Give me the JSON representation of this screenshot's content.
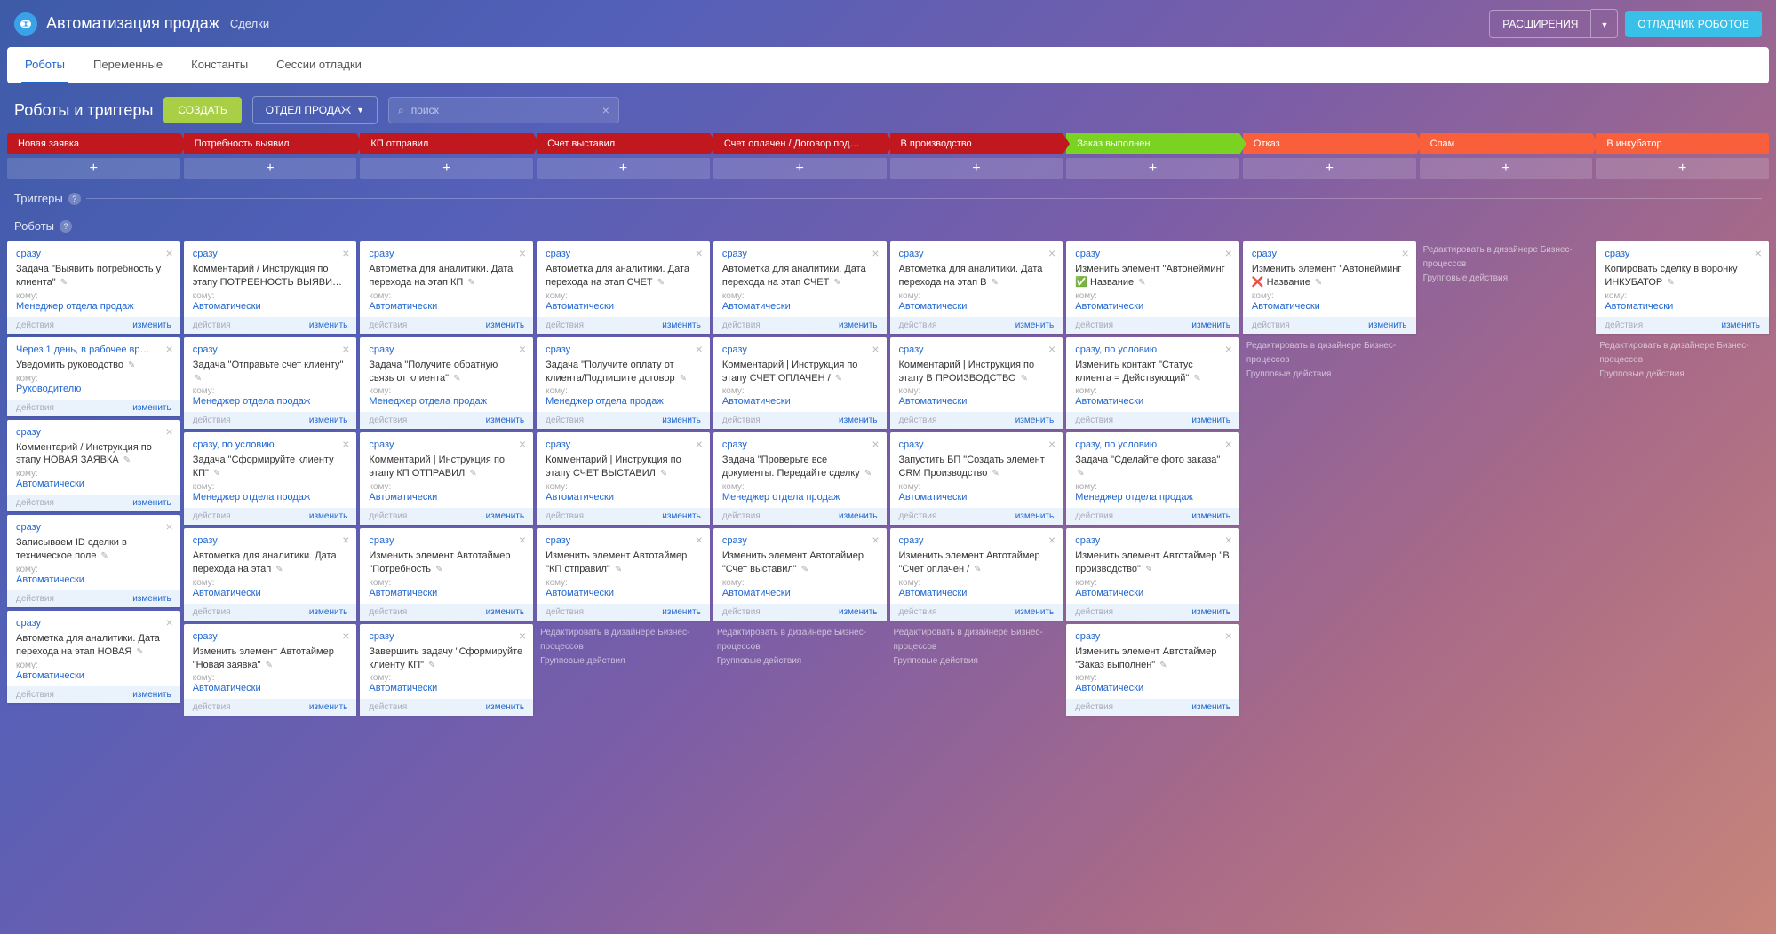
{
  "header": {
    "title": "Автоматизация продаж",
    "subtitle": "Сделки",
    "extensions": "РАСШИРЕНИЯ",
    "debugger": "ОТЛАДЧИК РОБОТОВ"
  },
  "tabs": [
    "Роботы",
    "Переменные",
    "Константы",
    "Сессии отладки"
  ],
  "activeTab": 0,
  "toolbar": {
    "section": "Роботы и триггеры",
    "create": "СОЗДАТЬ",
    "dept": "ОТДЕЛ ПРОДАЖ",
    "searchPlaceholder": "поиск"
  },
  "stages": [
    {
      "label": "Новая заявка",
      "bg": "#c1171f"
    },
    {
      "label": "Потребность выявил",
      "bg": "#c1171f"
    },
    {
      "label": "КП отправил",
      "bg": "#c1171f"
    },
    {
      "label": "Счет выставил",
      "bg": "#c1171f"
    },
    {
      "label": "Счет оплачен / Договор под…",
      "bg": "#c1171f"
    },
    {
      "label": "В производство",
      "bg": "#c1171f"
    },
    {
      "label": "Заказ выполнен",
      "bg": "#7ad321"
    },
    {
      "label": "Отказ",
      "bg": "#f85f3a"
    },
    {
      "label": "Спам",
      "bg": "#f85f3a"
    },
    {
      "label": "В инкубатор",
      "bg": "#f85f3a"
    }
  ],
  "labels": {
    "triggers": "Триггеры",
    "robots": "Роботы",
    "add": "+",
    "to": "кому:",
    "actions": "действия",
    "edit": "изменить",
    "link1": "Редактировать в дизайнере Бизнес-процессов",
    "link2": "Групповые действия"
  },
  "columns": [
    [
      {
        "when": "сразу",
        "desc": "Задача \"Выявить потребность у клиента\"",
        "to": "Менеджер отдела продаж"
      },
      {
        "when": "Через 1 день, в рабочее вр…",
        "desc": "Уведомить руководство",
        "to": "Руководителю"
      },
      {
        "when": "сразу",
        "desc": "Комментарий / Инструкция по этапу НОВАЯ ЗАЯВКА",
        "to": "Автоматически"
      },
      {
        "when": "сразу",
        "desc": "Записываем ID сделки в техническое поле",
        "to": "Автоматически"
      },
      {
        "when": "сразу",
        "desc": "Автометка для аналитики. Дата перехода на этап НОВАЯ",
        "to": "Автоматически"
      }
    ],
    [
      {
        "when": "сразу",
        "desc": "Комментарий / Инструкция по этапу ПОТРЕБНОСТЬ ВЫЯВИЛ",
        "to": "Автоматически"
      },
      {
        "when": "сразу",
        "desc": "Задача \"Отправьте счет клиенту\"",
        "to": "Менеджер отдела продаж"
      },
      {
        "when": "сразу, по условию",
        "desc": "Задача \"Сформируйте клиенту КП\"",
        "to": "Менеджер отдела продаж"
      },
      {
        "when": "сразу",
        "desc": "Автометка для аналитики. Дата перехода на этап",
        "to": "Автоматически"
      },
      {
        "when": "сразу",
        "desc": "Изменить элемент Автотаймер \"Новая заявка\"",
        "to": "Автоматически"
      }
    ],
    [
      {
        "when": "сразу",
        "desc": "Автометка для аналитики. Дата перехода на этап КП",
        "to": "Автоматически"
      },
      {
        "when": "сразу",
        "desc": "Задача \"Получите обратную связь от клиента\"",
        "to": "Менеджер отдела продаж"
      },
      {
        "when": "сразу",
        "desc": "Комментарий | Инструкция по этапу КП ОТПРАВИЛ",
        "to": "Автоматически"
      },
      {
        "when": "сразу",
        "desc": "Изменить элемент Автотаймер \"Потребность",
        "to": "Автоматически"
      },
      {
        "when": "сразу",
        "desc": "Завершить задачу \"Сформируйте клиенту КП\"",
        "to": "Автоматически"
      }
    ],
    [
      {
        "when": "сразу",
        "desc": "Автометка для аналитики. Дата перехода на этап СЧЕТ",
        "to": "Автоматически"
      },
      {
        "when": "сразу",
        "desc": "Задача \"Получите оплату от клиента/Подпишите договор",
        "to": "Менеджер отдела продаж"
      },
      {
        "when": "сразу",
        "desc": "Комментарий | Инструкция по этапу СЧЕТ ВЫСТАВИЛ",
        "to": "Автоматически"
      },
      {
        "when": "сразу",
        "desc": "Изменить элемент Автотаймер \"КП отправил\"",
        "to": "Автоматически"
      },
      "links"
    ],
    [
      {
        "when": "сразу",
        "desc": "Автометка для аналитики. Дата перехода на этап СЧЕТ",
        "to": "Автоматически"
      },
      {
        "when": "сразу",
        "desc": "Комментарий | Инструкция по этапу СЧЕТ ОПЛАЧЕН /",
        "to": "Автоматически"
      },
      {
        "when": "сразу",
        "desc": "Задача \"Проверьте все документы. Передайте сделку",
        "to": "Менеджер отдела продаж"
      },
      {
        "when": "сразу",
        "desc": "Изменить элемент Автотаймер \"Счет выставил\"",
        "to": "Автоматически"
      },
      "links"
    ],
    [
      {
        "when": "сразу",
        "desc": "Автометка для аналитики. Дата перехода на этап В",
        "to": "Автоматически"
      },
      {
        "when": "сразу",
        "desc": "Комментарий | Инструкция по этапу В ПРОИЗВОДСТВО",
        "to": "Автоматически"
      },
      {
        "when": "сразу",
        "desc": "Запустить БП \"Создать элемент CRM Производство",
        "to": "Автоматически"
      },
      {
        "when": "сразу",
        "desc": "Изменить элемент Автотаймер \"Счет оплачен /",
        "to": "Автоматически"
      },
      "links"
    ],
    [
      {
        "when": "сразу",
        "desc": "Изменить элемент \"Автонейминг ✅ Название",
        "to": "Автоматически"
      },
      {
        "when": "сразу, по условию",
        "desc": "Изменить контакт \"Статус клиента = Действующий\"",
        "to": "Автоматически"
      },
      {
        "when": "сразу, по условию",
        "desc": "Задача \"Сделайте фото заказа\"",
        "to": "Менеджер отдела продаж"
      },
      {
        "when": "сразу",
        "desc": "Изменить элемент Автотаймер \"В производство\"",
        "to": "Автоматически"
      },
      {
        "when": "сразу",
        "desc": "Изменить элемент Автотаймер \"Заказ выполнен\"",
        "to": "Автоматически"
      }
    ],
    [
      {
        "when": "сразу",
        "desc": "Изменить элемент \"Автонейминг ❌ Название",
        "to": "Автоматически"
      },
      "links"
    ],
    [
      "links"
    ],
    [
      {
        "when": "сразу",
        "desc": "Копировать сделку в воронку ИНКУБАТОР",
        "to": "Автоматически"
      },
      "links"
    ]
  ]
}
